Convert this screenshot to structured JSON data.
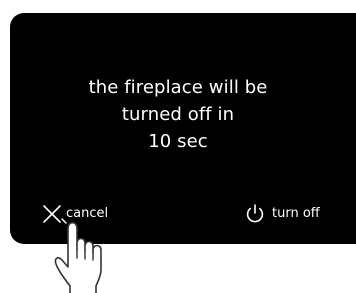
{
  "dialog": {
    "message_lines": [
      "the fireplace will be",
      "turned off in",
      "10 sec"
    ]
  },
  "actions": {
    "cancel": {
      "label": "cancel",
      "icon": "close-icon"
    },
    "turn_off": {
      "label": "turn off",
      "icon": "power-icon"
    }
  },
  "decoration": {
    "icon": "tap-hand-icon"
  },
  "colors": {
    "panel_background": "#000000",
    "text": "#ffffff",
    "page_background": "#ffffff",
    "hand_outline": "#333333"
  }
}
